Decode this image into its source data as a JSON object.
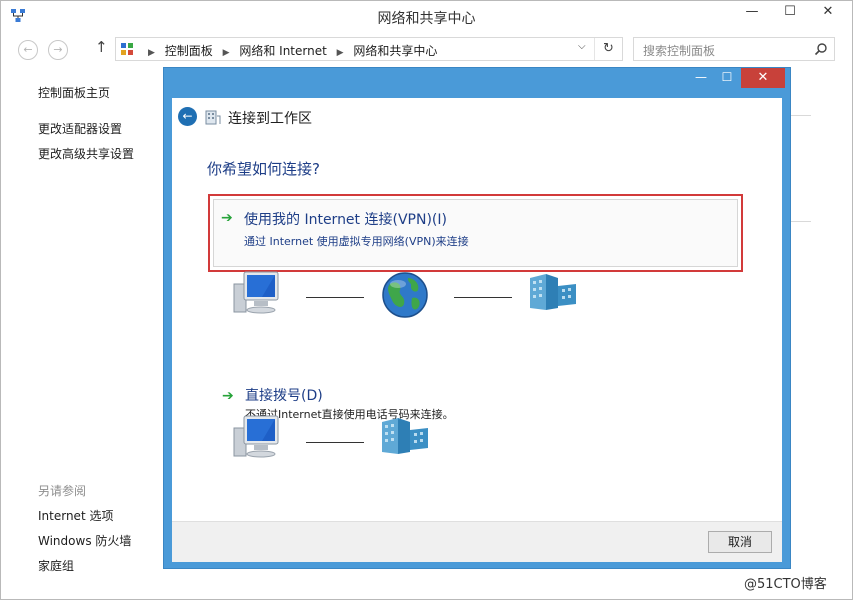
{
  "window": {
    "title": "网络和共享中心",
    "controls": {
      "minimize": "—",
      "maximize": "☐",
      "close": "✕"
    }
  },
  "navigation": {
    "back": "←",
    "forward": "→",
    "up": "↑",
    "breadcrumbs": [
      "控制面板",
      "网络和 Internet",
      "网络和共享中心"
    ],
    "dropdown": "⌵",
    "refresh": "↻"
  },
  "search": {
    "placeholder": "搜索控制面板"
  },
  "left_pane": {
    "home": "控制面板主页",
    "adapter": "更改适配器设置",
    "advanced": "更改高级共享设置",
    "see_also": "另请参阅",
    "internet_options": "Internet 选项",
    "firewall": "Windows 防火墙",
    "homegroup": "家庭组"
  },
  "dialog": {
    "controls": {
      "minimize": "—",
      "maximize": "☐",
      "close": "✕"
    },
    "back": "←",
    "title": "连接到工作区",
    "question": "你希望如何连接?",
    "vpn_option": {
      "arrow": "➔",
      "title": "使用我的 Internet 连接(VPN)(I)",
      "description": "通过 Internet 使用虚拟专用网络(VPN)来连接"
    },
    "dial_option": {
      "arrow": "➔",
      "title": "直接拨号(D)",
      "description": "不通过Internet直接使用电话号码来连接。"
    },
    "cancel": "取消"
  },
  "icons": {
    "app": "network-control-panel-icon",
    "computer": "computer-icon",
    "globe": "globe-icon",
    "building": "office-building-icon"
  },
  "colors": {
    "dialog_frame": "#4a9ad8",
    "close_red": "#c8413a",
    "highlight_border": "#d23a3a",
    "link_blue": "#1e3e87",
    "green_arrow": "#27a33a"
  },
  "watermark": "@51CTO博客"
}
